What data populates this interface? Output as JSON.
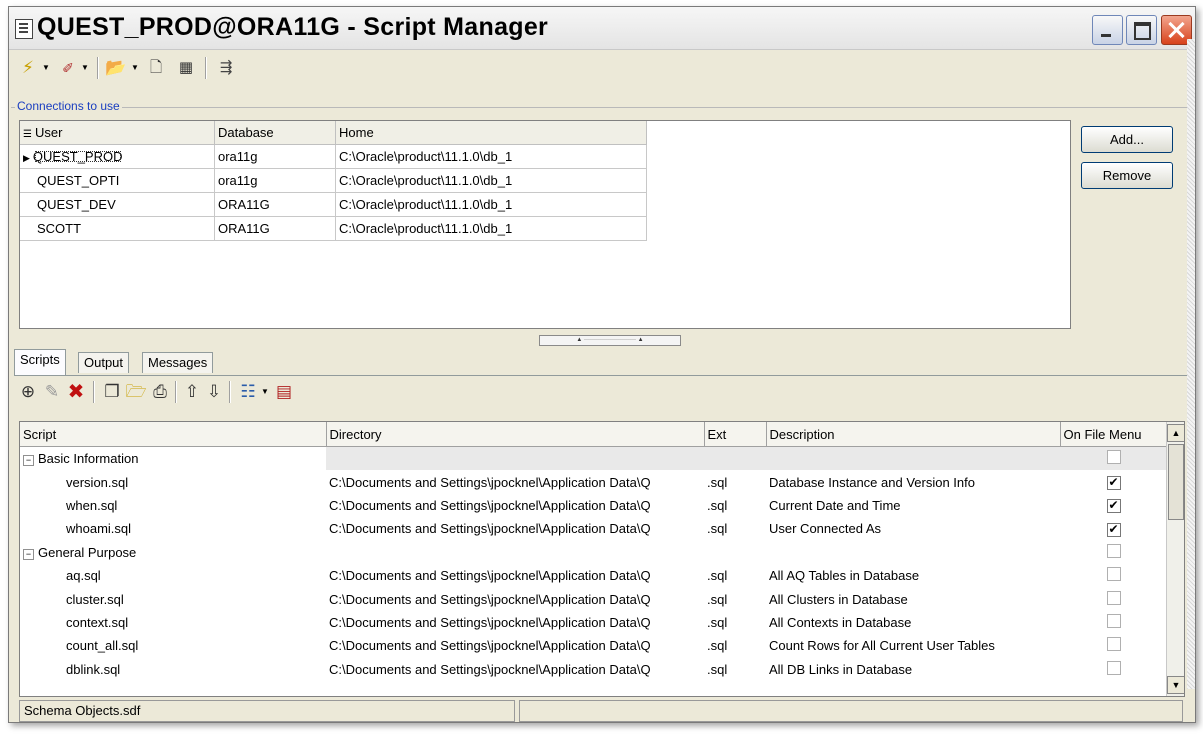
{
  "window": {
    "title": "QUEST_PROD@ORA11G - Script Manager"
  },
  "toolbar1": {
    "icons": [
      "lightning-icon",
      "pen-arrow-icon",
      "open-folder-icon",
      "new-document-icon",
      "film-icon",
      "run-script-icon"
    ]
  },
  "connections": {
    "legend": "Connections to use",
    "columns": [
      "User",
      "Database",
      "Home"
    ],
    "rows": [
      {
        "user": "QUEST_PROD",
        "database": "ora11g",
        "home": "C:\\Oracle\\product\\11.1.0\\db_1",
        "selected": true
      },
      {
        "user": "QUEST_OPTI",
        "database": "ora11g",
        "home": "C:\\Oracle\\product\\11.1.0\\db_1"
      },
      {
        "user": "QUEST_DEV",
        "database": "ORA11G",
        "home": "C:\\Oracle\\product\\11.1.0\\db_1"
      },
      {
        "user": "SCOTT",
        "database": "ORA11G",
        "home": "C:\\Oracle\\product\\11.1.0\\db_1"
      }
    ],
    "add_label": "Add...",
    "remove_label": "Remove"
  },
  "tabs": [
    {
      "label": "Scripts",
      "active": true
    },
    {
      "label": "Output"
    },
    {
      "label": "Messages"
    }
  ],
  "scripts": {
    "columns": [
      "Script",
      "Directory",
      "Ext",
      "Description",
      "On File Menu"
    ],
    "groups": [
      {
        "name": "Basic Information",
        "items": [
          {
            "script": "version.sql",
            "directory": "C:\\Documents and Settings\\jpocknel\\Application Data\\Q",
            "ext": ".sql",
            "description": "Database Instance and Version Info",
            "on_menu": true
          },
          {
            "script": "when.sql",
            "directory": "C:\\Documents and Settings\\jpocknel\\Application Data\\Q",
            "ext": ".sql",
            "description": "Current Date and Time",
            "on_menu": true
          },
          {
            "script": "whoami.sql",
            "directory": "C:\\Documents and Settings\\jpocknel\\Application Data\\Q",
            "ext": ".sql",
            "description": "User Connected As",
            "on_menu": true
          }
        ]
      },
      {
        "name": "General Purpose",
        "items": [
          {
            "script": "aq.sql",
            "directory": "C:\\Documents and Settings\\jpocknel\\Application Data\\Q",
            "ext": ".sql",
            "description": "All AQ Tables in Database",
            "on_menu": false
          },
          {
            "script": "cluster.sql",
            "directory": "C:\\Documents and Settings\\jpocknel\\Application Data\\Q",
            "ext": ".sql",
            "description": "All Clusters in Database",
            "on_menu": false
          },
          {
            "script": "context.sql",
            "directory": "C:\\Documents and Settings\\jpocknel\\Application Data\\Q",
            "ext": ".sql",
            "description": "All Contexts in Database",
            "on_menu": false
          },
          {
            "script": "count_all.sql",
            "directory": "C:\\Documents and Settings\\jpocknel\\Application Data\\Q",
            "ext": ".sql",
            "description": "Count Rows for All Current User Tables",
            "on_menu": false
          },
          {
            "script": "dblink.sql",
            "directory": "C:\\Documents and Settings\\jpocknel\\Application Data\\Q",
            "ext": ".sql",
            "description": "All DB Links in Database",
            "on_menu": false
          }
        ]
      }
    ]
  },
  "status": {
    "file": "Schema Objects.sdf"
  }
}
